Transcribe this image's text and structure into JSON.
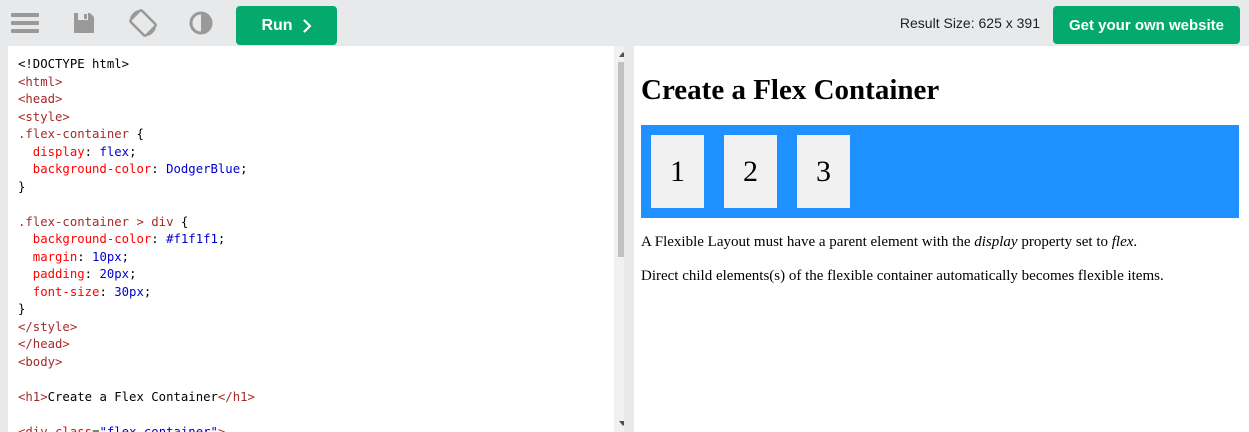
{
  "toolbar": {
    "icons": {
      "menu": "menu-icon",
      "save": "save-icon",
      "rotate": "rotate-icon",
      "theme": "theme-icon"
    },
    "run_label": "Run",
    "result_size_text": "Result Size: 625 x 391",
    "own_website_label": "Get your own website",
    "accent_color": "#04aa6d"
  },
  "editor": {
    "lines": [
      [
        {
          "t": "x",
          "s": "<!DOCTYPE html>"
        }
      ],
      [
        {
          "t": "t",
          "s": "<html>"
        }
      ],
      [
        {
          "t": "t",
          "s": "<head>"
        }
      ],
      [
        {
          "t": "t",
          "s": "<style>"
        }
      ],
      [
        {
          "t": "n",
          "s": ".flex-container "
        },
        {
          "t": "x",
          "s": "{"
        }
      ],
      [
        {
          "t": "p",
          "s": "  display"
        },
        {
          "t": "x",
          "s": ": "
        },
        {
          "t": "v",
          "s": "flex"
        },
        {
          "t": "x",
          "s": ";"
        }
      ],
      [
        {
          "t": "p",
          "s": "  background-color"
        },
        {
          "t": "x",
          "s": ": "
        },
        {
          "t": "v",
          "s": "DodgerBlue"
        },
        {
          "t": "x",
          "s": ";"
        }
      ],
      [
        {
          "t": "x",
          "s": "}"
        }
      ],
      [
        {
          "t": "x",
          "s": ""
        }
      ],
      [
        {
          "t": "n",
          "s": ".flex-container > div "
        },
        {
          "t": "x",
          "s": "{"
        }
      ],
      [
        {
          "t": "p",
          "s": "  background-color"
        },
        {
          "t": "x",
          "s": ": "
        },
        {
          "t": "v",
          "s": "#f1f1f1"
        },
        {
          "t": "x",
          "s": ";"
        }
      ],
      [
        {
          "t": "p",
          "s": "  margin"
        },
        {
          "t": "x",
          "s": ": "
        },
        {
          "t": "v",
          "s": "10px"
        },
        {
          "t": "x",
          "s": ";"
        }
      ],
      [
        {
          "t": "p",
          "s": "  padding"
        },
        {
          "t": "x",
          "s": ": "
        },
        {
          "t": "v",
          "s": "20px"
        },
        {
          "t": "x",
          "s": ";"
        }
      ],
      [
        {
          "t": "p",
          "s": "  font-size"
        },
        {
          "t": "x",
          "s": ": "
        },
        {
          "t": "v",
          "s": "30px"
        },
        {
          "t": "x",
          "s": ";"
        }
      ],
      [
        {
          "t": "x",
          "s": "}"
        }
      ],
      [
        {
          "t": "t",
          "s": "</style>"
        }
      ],
      [
        {
          "t": "t",
          "s": "</head>"
        }
      ],
      [
        {
          "t": "t",
          "s": "<body>"
        }
      ],
      [
        {
          "t": "x",
          "s": ""
        }
      ],
      [
        {
          "t": "t",
          "s": "<h1>"
        },
        {
          "t": "x",
          "s": "Create a Flex Container"
        },
        {
          "t": "t",
          "s": "</h1>"
        }
      ],
      [
        {
          "t": "x",
          "s": ""
        }
      ],
      [
        {
          "t": "t",
          "s": "<div "
        },
        {
          "t": "p",
          "s": "class"
        },
        {
          "t": "x",
          "s": "="
        },
        {
          "t": "v",
          "s": "\"flex-container\""
        },
        {
          "t": "t",
          "s": ">"
        }
      ]
    ]
  },
  "result": {
    "heading": "Create a Flex Container",
    "container_color": "#1e90ff",
    "items": [
      "1",
      "2",
      "3"
    ],
    "p1": {
      "before": "A Flexible Layout must have a parent element with the ",
      "em1": "display",
      "middle": " property set to ",
      "em2": "flex",
      "after": "."
    },
    "p2": "Direct child elements(s) of the flexible container automatically becomes flexible items."
  }
}
